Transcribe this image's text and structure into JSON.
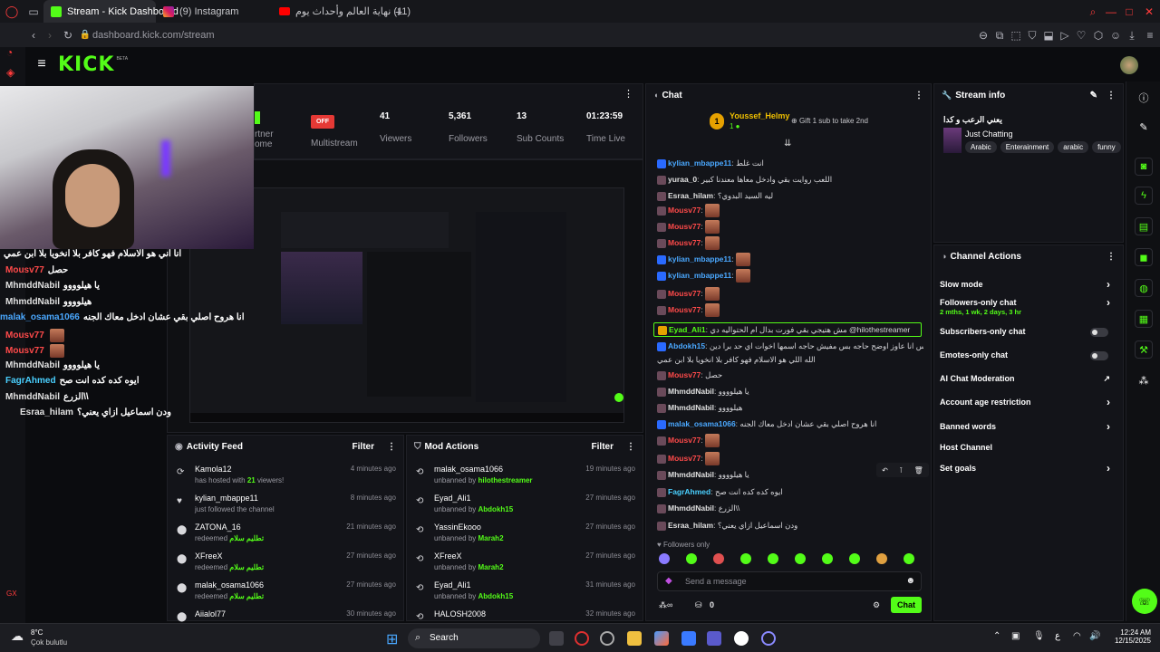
{
  "browser": {
    "tabs": [
      {
        "label": "Stream - Kick Dashboard"
      },
      {
        "label": "(9) Instagram"
      },
      {
        "label": "(11) نهاية العالم وأحداث يوم"
      }
    ],
    "url_host": "dashboard.kick.com",
    "url_path": "/stream"
  },
  "header": {
    "logo": "KICK",
    "beta": "BETA"
  },
  "stats": [
    {
      "value": "",
      "label": "rtner",
      "sub": "ome"
    },
    {
      "value": "OFF",
      "label": "Multistream"
    },
    {
      "value": "41",
      "label": "Viewers"
    },
    {
      "value": "5,361",
      "label": "Followers"
    },
    {
      "value": "13",
      "label": "Sub Counts"
    },
    {
      "value": "01:23:59",
      "label": "Time Live"
    }
  ],
  "overlay_chat": [
    {
      "user": "",
      "msg": "انا اني هو الاسلام فهو كافر بلا انخويا بلا ابن عمي",
      "color": "#ffffff"
    },
    {
      "user": "Mousv77",
      "msg": "حصل",
      "color": "#ff4a4a"
    },
    {
      "user": "MhmddNabil",
      "msg": "يا هيلوووو",
      "color": "#e0e0e0"
    },
    {
      "user": "MhmddNabil",
      "msg": "هيلوووو",
      "color": "#e0e0e0"
    },
    {
      "user": "malak_osama1066",
      "msg": "انا هروح اصلي بقي عشان ادخل معاك الجنه",
      "color": "#4aa8ff"
    },
    {
      "user": "Mousv77",
      "msg": "",
      "color": "#ff4a4a"
    },
    {
      "user": "Mousv77",
      "msg": "",
      "color": "#ff4a4a"
    },
    {
      "user": "MhmddNabil",
      "msg": "يا هيلوووو",
      "color": "#e0e0e0"
    },
    {
      "user": "FagrAhmed",
      "msg": "ايوه كده كده انت صح",
      "color": "#4ad0ff"
    },
    {
      "user": "MhmddNabil",
      "msg": "الزرع\\\\",
      "color": "#e0e0e0"
    },
    {
      "user": "Esraa_hilam",
      "msg": "ودن اسماعيل ازاي يعني؟",
      "color": "#e0e0e0"
    }
  ],
  "activity": {
    "title": "Activity Feed",
    "filter": "Filter",
    "items": [
      {
        "name": "Kamola12",
        "sub_pre": "has hosted with ",
        "sub_hl": "21",
        "sub_post": " viewers!",
        "time": "4 minutes ago"
      },
      {
        "name": "kylian_mbappe11",
        "sub_pre": "just followed the channel",
        "sub_hl": "",
        "sub_post": "",
        "time": "8 minutes ago"
      },
      {
        "name": "ZATONA_16",
        "sub_pre": "redeemed ",
        "sub_hl": "تطليم سلام",
        "sub_post": "",
        "time": "21 minutes ago"
      },
      {
        "name": "XFreeX",
        "sub_pre": "redeemed ",
        "sub_hl": "تطليم سلام",
        "sub_post": "",
        "time": "27 minutes ago"
      },
      {
        "name": "malak_osama1066",
        "sub_pre": "redeemed ",
        "sub_hl": "تطليم سلام",
        "sub_post": "",
        "time": "27 minutes ago"
      },
      {
        "name": "Aiialol77",
        "sub_pre": "",
        "sub_hl": "",
        "sub_post": "",
        "time": "30 minutes ago"
      }
    ]
  },
  "mod": {
    "title": "Mod Actions",
    "filter": "Filter",
    "items": [
      {
        "name": "malak_osama1066",
        "sub_pre": "unbanned by ",
        "sub_hl": "hilothestreamer",
        "time": "19 minutes ago"
      },
      {
        "name": "Eyad_Ali1",
        "sub_pre": "unbanned by ",
        "sub_hl": "Abdokh15",
        "time": "27 minutes ago"
      },
      {
        "name": "YassinEkooo",
        "sub_pre": "unbanned by ",
        "sub_hl": "Marah2",
        "time": "27 minutes ago"
      },
      {
        "name": "XFreeX",
        "sub_pre": "unbanned by ",
        "sub_hl": "Marah2",
        "time": "27 minutes ago"
      },
      {
        "name": "Eyad_Ali1",
        "sub_pre": "unbanned by ",
        "sub_hl": "Abdokh15",
        "time": "31 minutes ago"
      },
      {
        "name": "HALOSH2008",
        "sub_pre": "",
        "sub_hl": "",
        "time": "32 minutes ago"
      }
    ]
  },
  "chat": {
    "title": "Chat",
    "pinned_user": "Youssef_Helmy",
    "pinned_rank": "1",
    "gift_text": "Gift 1 sub to take 2nd",
    "messages": [
      {
        "user": "kylian_mbappe11",
        "msg": "انت غلط",
        "color": "#4aa8ff",
        "emote": false
      },
      {
        "user": "yuraa_0",
        "msg": "اللعب روايت بقي وادخل معاها معندنا كبير",
        "color": "#e0e0e0",
        "emote": false
      },
      {
        "user": "Esraa_hilam",
        "msg": "ليه السيد البدوي؟",
        "color": "#e0e0e0",
        "emote": false
      },
      {
        "user": "Mousv77",
        "msg": "",
        "color": "#ff4a4a",
        "emote": true
      },
      {
        "user": "Mousv77",
        "msg": "",
        "color": "#ff4a4a",
        "emote": true
      },
      {
        "user": "Mousv77",
        "msg": "",
        "color": "#ff4a4a",
        "emote": true
      },
      {
        "user": "kylian_mbappe11",
        "msg": "",
        "color": "#4aa8ff",
        "emote": true
      },
      {
        "user": "kylian_mbappe11",
        "msg": "",
        "color": "#4aa8ff",
        "emote": true
      },
      {
        "user": "Mousv77",
        "msg": "",
        "color": "#ff4a4a",
        "emote": true
      },
      {
        "user": "Mousv77",
        "msg": "",
        "color": "#ff4a4a",
        "emote": true
      },
      {
        "user": "Eyad_Ali1",
        "msg": "مش هتيجي بقي فورت بدال ام الحتواليه دي @hilothestreamer",
        "color": "#53fc18",
        "emote": false
      },
      {
        "user": "Abdokh15",
        "msg": "مس انا عاوز اوضح حاجه بس مفيش حاجه اسمها اخوات اي حد برا دين",
        "color": "#4aa8ff",
        "emote": false
      },
      {
        "user": "",
        "msg": "الله اللي هو الاسلام فهو كافر بلا انخويا بلا ابن عمي",
        "color": "#e0e0e0",
        "emote": false
      },
      {
        "user": "Mousv77",
        "msg": "حصل",
        "color": "#ff4a4a",
        "emote": false
      },
      {
        "user": "MhmddNabil",
        "msg": "يا هيلوووو",
        "color": "#e0e0e0",
        "emote": false
      },
      {
        "user": "MhmddNabil",
        "msg": "هيلوووو",
        "color": "#e0e0e0",
        "emote": false
      },
      {
        "user": "malak_osama1066",
        "msg": "انا هروح اصلي بقي عشان ادخل معاك الجنه",
        "color": "#4aa8ff",
        "emote": false
      },
      {
        "user": "Mousv77",
        "msg": "",
        "color": "#ff4a4a",
        "emote": true
      },
      {
        "user": "Mousv77",
        "msg": "",
        "color": "#ff4a4a",
        "emote": true
      },
      {
        "user": "MhmddNabil",
        "msg": "يا هيلوووو",
        "color": "#e0e0e0",
        "emote": false
      },
      {
        "user": "FagrAhmed",
        "msg": "ايوه كده كده انت صح",
        "color": "#4ad0ff",
        "emote": false
      },
      {
        "user": "MhmddNabil",
        "msg": "الزرع\\\\",
        "color": "#e0e0e0",
        "emote": false
      },
      {
        "user": "Esraa_hilam",
        "msg": "ودن اسماعيل ازاي يعني؟",
        "color": "#e0e0e0",
        "emote": false
      }
    ],
    "followers_only": "Followers only",
    "placeholder": "Send a message",
    "count": "0",
    "send": "Chat"
  },
  "stream_info": {
    "title": "Stream info",
    "stream_title": "يعني الرعب و كدا",
    "category": "Just Chatting",
    "tags": [
      "Arabic",
      "Enterainment",
      "arabic",
      "funny"
    ]
  },
  "channel_actions": {
    "title": "Channel Actions",
    "items": [
      {
        "label": "Slow mode",
        "type": "chevron"
      },
      {
        "label": "Followers-only chat",
        "sub": "2 mths, 1 wk, 2 days, 3 hr",
        "type": "chevron"
      },
      {
        "label": "Subscribers-only chat",
        "type": "toggle"
      },
      {
        "label": "Emotes-only chat",
        "type": "toggle"
      },
      {
        "label": "AI Chat Moderation",
        "type": "external"
      },
      {
        "label": "Account age restriction",
        "type": "chevron"
      },
      {
        "label": "Banned words",
        "type": "chevron"
      },
      {
        "label": "Host Channel",
        "type": "none"
      },
      {
        "label": "Set goals",
        "type": "chevron"
      }
    ]
  },
  "taskbar": {
    "weather_temp": "8°C",
    "weather_desc": "Çok bulutlu",
    "search": "Search",
    "lang": "ع",
    "time": "12:24 AM",
    "date": "12/15/2025"
  },
  "colors": {
    "accent": "#53fc18",
    "bg": "#0b0c0f",
    "panel": "#131419"
  }
}
